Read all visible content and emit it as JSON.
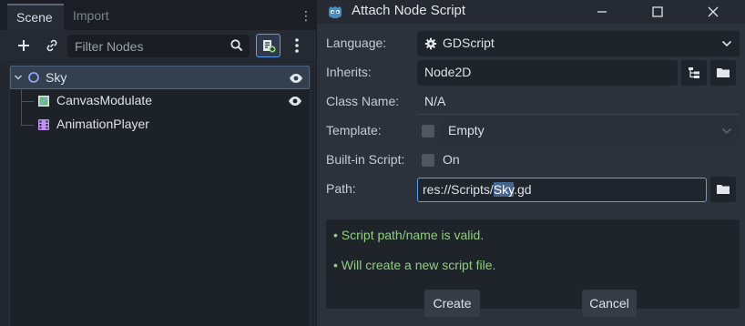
{
  "scene_dock": {
    "tabs": [
      {
        "label": "Scene",
        "active": true
      },
      {
        "label": "Import",
        "active": false
      }
    ],
    "menu_glyph": "⋮",
    "filter": {
      "placeholder": "Filter Nodes",
      "value": ""
    },
    "tree": [
      {
        "label": "Sky",
        "type": "node2d",
        "selected": true,
        "visible_toggle": true
      },
      {
        "label": "CanvasModulate",
        "type": "canvas-modulate",
        "selected": false,
        "visible_toggle": true
      },
      {
        "label": "AnimationPlayer",
        "type": "animation-player",
        "selected": false,
        "visible_toggle": false
      }
    ]
  },
  "dialog": {
    "title": "Attach Node Script",
    "fields": {
      "language": {
        "label": "Language:",
        "value": "GDScript"
      },
      "inherits": {
        "label": "Inherits:",
        "value": "Node2D"
      },
      "class_name": {
        "label": "Class Name:",
        "value": "N/A"
      },
      "template": {
        "label": "Template:",
        "value": "Empty",
        "enabled": false
      },
      "builtin": {
        "label": "Built-in Script:",
        "value": "On",
        "checked": false
      },
      "path": {
        "label": "Path:",
        "prefix": "res://Scripts/",
        "selected_part": "Sky",
        "suffix": ".gd"
      }
    },
    "messages": [
      "Script path/name is valid.",
      "Will create a new script file."
    ],
    "bullet": "•",
    "buttons": {
      "create": "Create",
      "cancel": "Cancel"
    }
  },
  "colors": {
    "accent": "#5b9cf0",
    "valid_message": "#8ed07f",
    "godot_logo": "#478cbf"
  }
}
